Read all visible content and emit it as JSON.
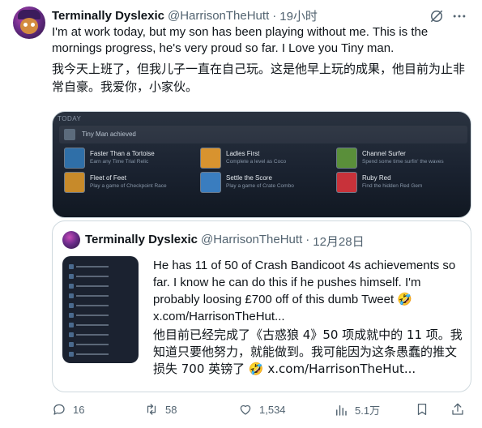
{
  "tweet": {
    "author_name": "Terminally Dyslexic",
    "author_handle": "@HarrisonTheHutt",
    "separator": "·",
    "time": "19小时",
    "text_en": "I'm at work today, but my son has been playing without me. This is the mornings progress, he's very proud so far. I Love you Tiny man.",
    "text_zh": "我今天上班了，但我儿子一直在自己玩。这是他早上玩的成果，他目前为止非常自豪。我爱你，小家伙。"
  },
  "achievements": {
    "section_label": "TODAY",
    "user_line": "Tiny Man achieved",
    "items": [
      {
        "title": "Faster Than a Tortoise",
        "desc": "Earn any Time Trial Relic",
        "color": "#2f6fa8"
      },
      {
        "title": "Ladies First",
        "desc": "Complete a level as Coco",
        "color": "#d8932f"
      },
      {
        "title": "Channel Surfer",
        "desc": "Spend some time surfin' the waves",
        "color": "#5a8f3a"
      },
      {
        "title": "Fleet of Feet",
        "desc": "Play a game of Checkpoint Race",
        "color": "#c78a2a"
      },
      {
        "title": "Settle the Score",
        "desc": "Play a game of Crate Combo",
        "color": "#3a7dbf"
      },
      {
        "title": "Ruby Red",
        "desc": "Find the hidden Red Gem",
        "color": "#c8323a"
      }
    ]
  },
  "quote": {
    "author_name": "Terminally Dyslexic",
    "author_handle": "@HarrisonTheHutt",
    "separator": "·",
    "date": "12月28日",
    "text_en": "He has 11 of 50 of Crash Bandicoot 4s achievements so far. I know he can do this if he pushes himself. I'm probably loosing £700 off of this dumb Tweet 🤣 x.com/HarrisonTheHut...",
    "text_zh": "他目前已经完成了《古惑狼 4》50 项成就中的 11 项。我知道只要他努力，就能做到。我可能因为这条愚蠢的推文损失 700 英镑了 🤣 x.com/HarrisonTheHut..."
  },
  "actions": {
    "replies": "16",
    "retweets": "58",
    "likes": "1,534",
    "views": "5.1万"
  },
  "colors": {
    "text_primary": "#0f1419",
    "text_secondary": "#536471",
    "border": "#cfd9de"
  }
}
